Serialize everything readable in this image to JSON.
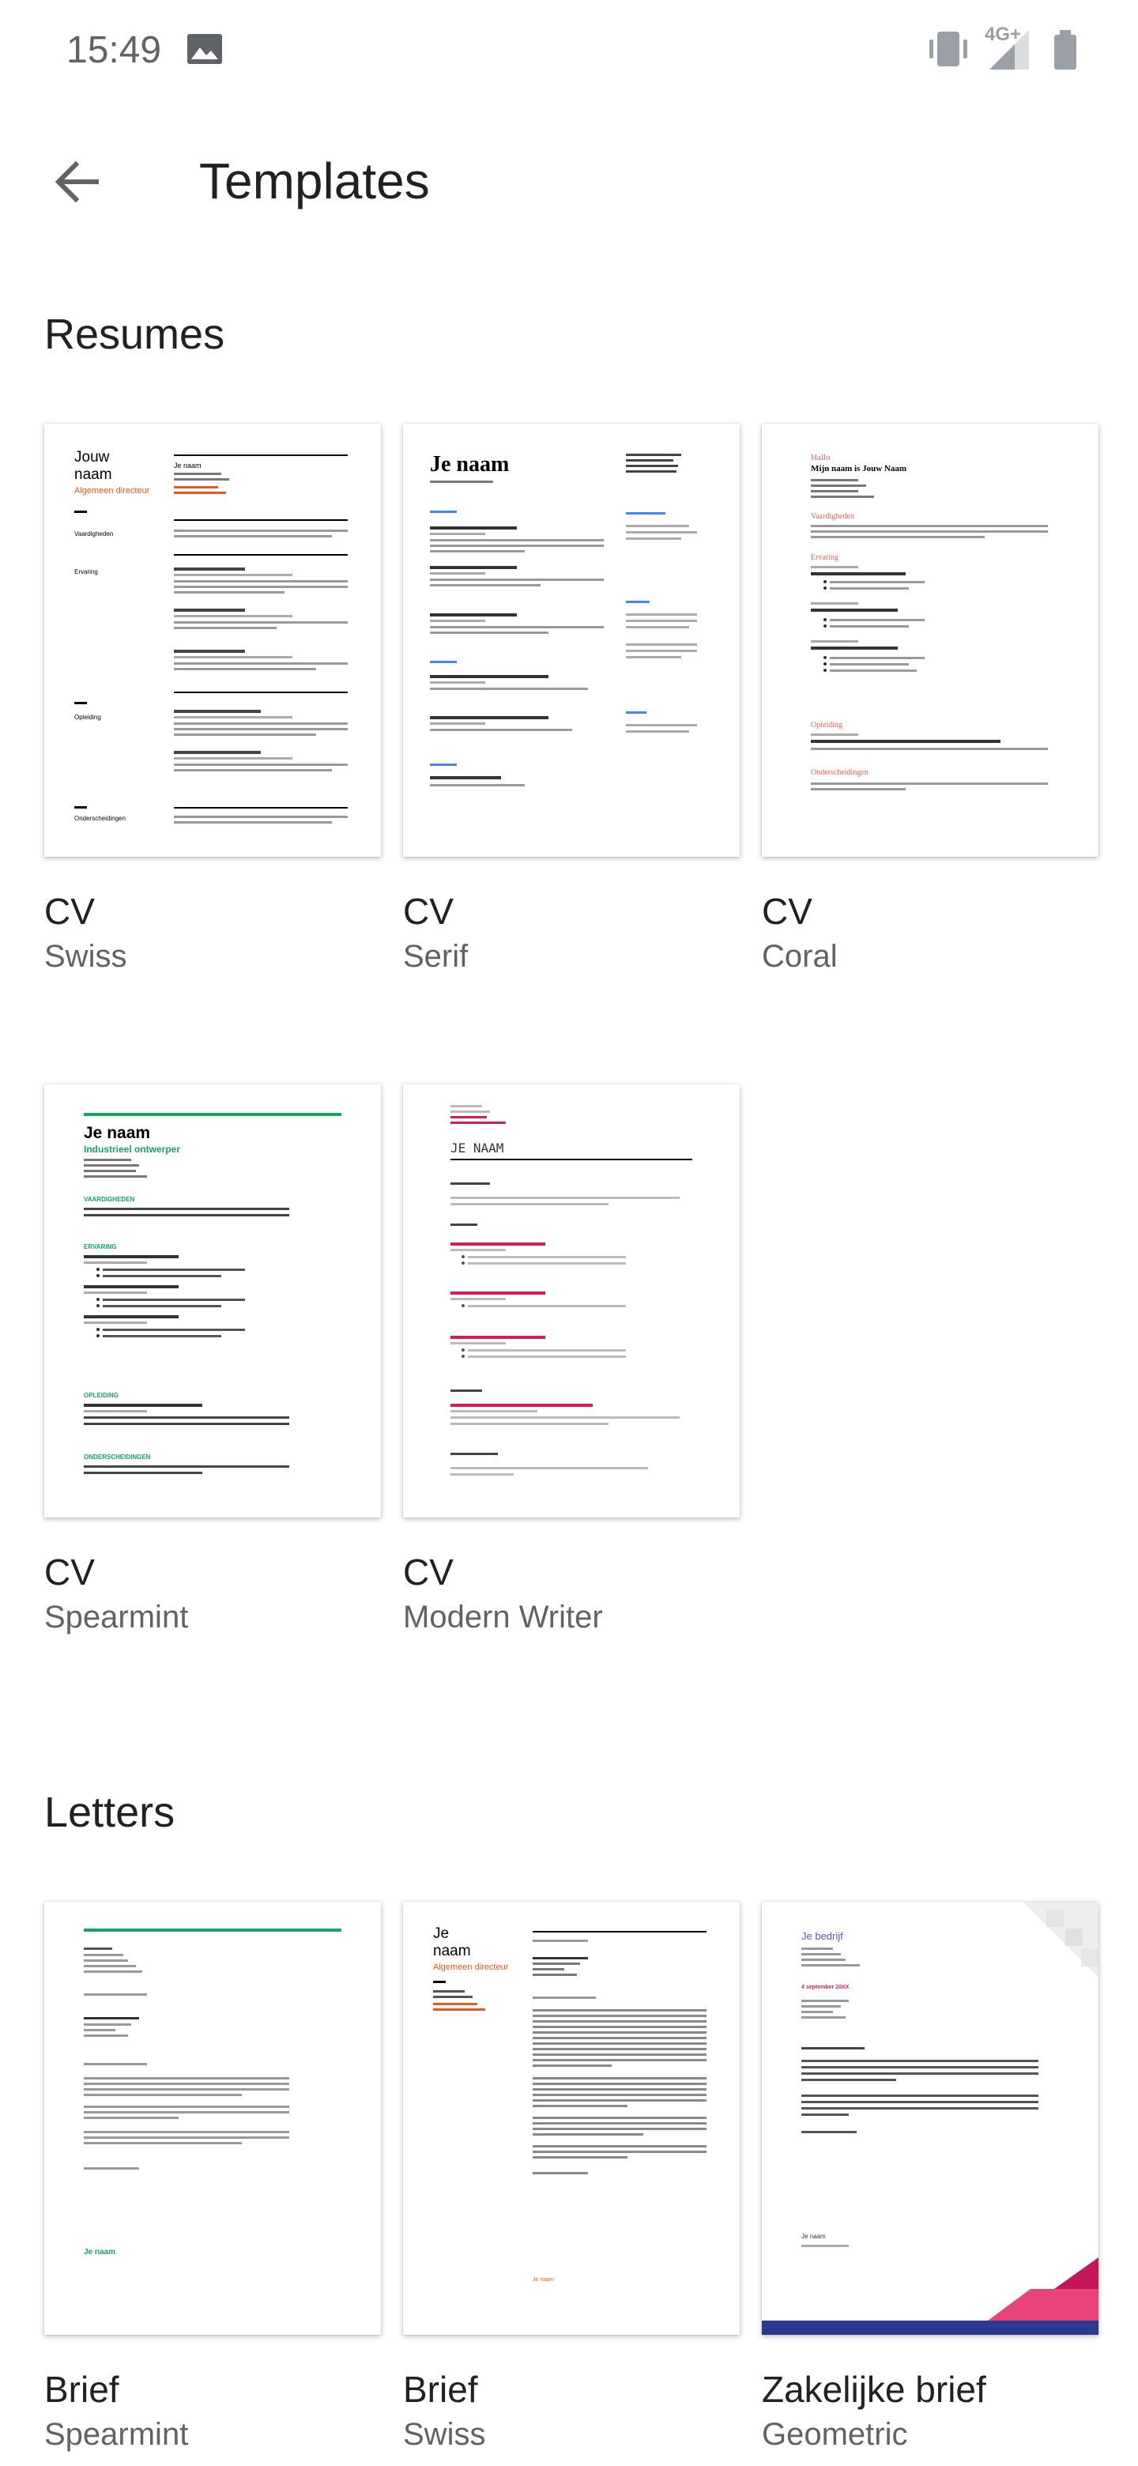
{
  "status_bar": {
    "time": "15:49",
    "network": "4G+"
  },
  "app_bar": {
    "title": "Templates"
  },
  "sections": [
    {
      "title": "Resumes",
      "templates": [
        {
          "name": "CV",
          "style": "Swiss"
        },
        {
          "name": "CV",
          "style": "Serif"
        },
        {
          "name": "CV",
          "style": "Coral"
        },
        {
          "name": "CV",
          "style": "Spearmint"
        },
        {
          "name": "CV",
          "style": "Modern Writer"
        }
      ]
    },
    {
      "title": "Letters",
      "templates": [
        {
          "name": "Brief",
          "style": "Spearmint"
        },
        {
          "name": "Brief",
          "style": "Swiss"
        },
        {
          "name": "Zakelijke brief",
          "style": "Geometric"
        }
      ]
    }
  ],
  "previews": {
    "cv_swiss": {
      "name_line1": "Jouw",
      "name_line2": "naam",
      "role": "Algemeen directeur",
      "contact_name": "Je naam",
      "headings": [
        "Vaardigheden",
        "Ervaring",
        "Opleiding",
        "Onderscheidingen"
      ]
    },
    "cv_serif": {
      "name": "Je naam"
    },
    "cv_coral": {
      "greeting": "Hallo",
      "name": "Mijn naam is Jouw Naam",
      "headings": [
        "Vaardigheden",
        "Ervaring",
        "Opleiding",
        "Onderscheidingen"
      ]
    },
    "cv_spearmint": {
      "name": "Je naam",
      "role": "Industrieel ontwerper",
      "headings": [
        "VAARDIGHEDEN",
        "ERVARING",
        "OPLEIDING",
        "ONDERSCHEIDINGEN"
      ]
    },
    "cv_modern_writer": {
      "name": "JE NAAM"
    },
    "brief_spearmint": {
      "signature": "Je naam"
    },
    "brief_swiss": {
      "name_line1": "Je",
      "name_line2": "naam",
      "role": "Algemeen directeur",
      "signature": "Je naam"
    },
    "brief_geometric": {
      "company": "Je bedrijf",
      "date": "4 september 20XX",
      "signature": "Je naam"
    }
  },
  "colors": {
    "accent_swiss": "#e8591a",
    "accent_coral": "#e06050",
    "accent_spearmint": "#1aa260",
    "accent_modern": "#d81b60",
    "accent_geometric": "#5c54d4",
    "accent_serif": "#4285f4"
  }
}
